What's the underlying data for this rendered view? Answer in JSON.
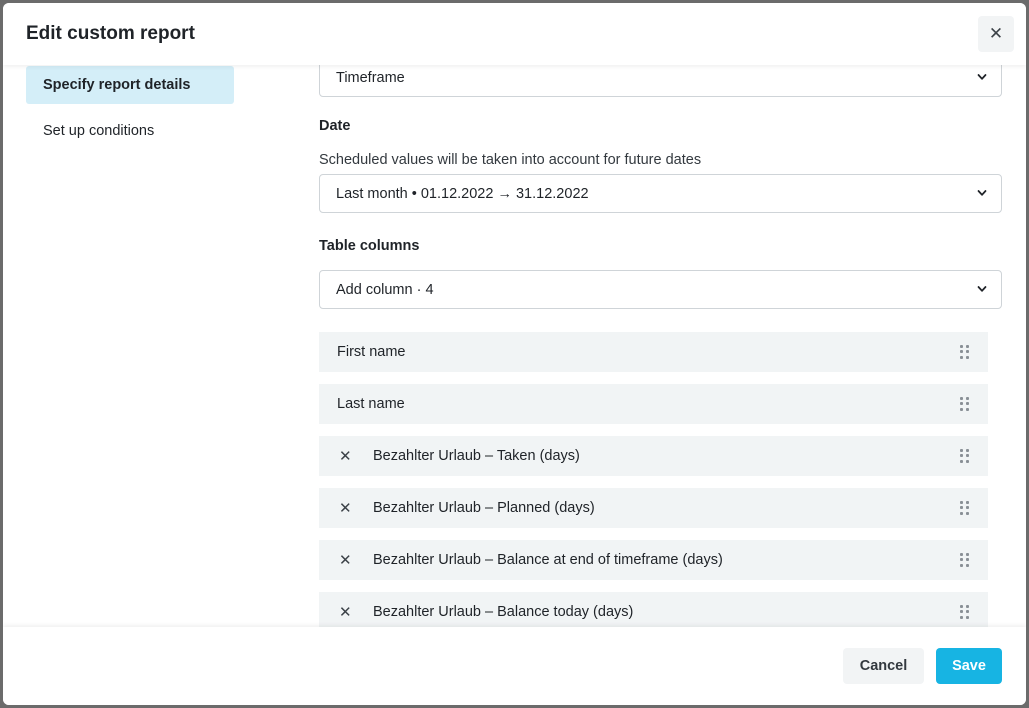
{
  "modal": {
    "title": "Edit custom report",
    "close_label": "✕"
  },
  "sidebar": {
    "items": [
      {
        "label": "Specify report details",
        "active": true
      },
      {
        "label": "Set up conditions",
        "active": false
      }
    ]
  },
  "form": {
    "timeframe_value": "Timeframe",
    "date_label": "Date",
    "date_hint": "Scheduled values will be taken into account for future dates",
    "date_value": "Last month • 01.12.2022 → 31.12.2022",
    "columns_label": "Table columns",
    "add_column_value": "Add column · 4",
    "columns": [
      {
        "label": "First name",
        "removable": false
      },
      {
        "label": "Last name",
        "removable": false
      },
      {
        "label": "Bezahlter Urlaub – Taken (days)",
        "removable": true
      },
      {
        "label": "Bezahlter Urlaub – Planned (days)",
        "removable": true
      },
      {
        "label": "Bezahlter Urlaub – Balance at end of timeframe (days)",
        "removable": true
      },
      {
        "label": "Bezahlter Urlaub – Balance today (days)",
        "removable": true
      }
    ],
    "remove_glyph": "✕"
  },
  "footer": {
    "cancel_label": "Cancel",
    "save_label": "Save"
  },
  "colors": {
    "accent": "#17b4e3",
    "sidebar_active": "#d4eef8",
    "row_background": "#f1f4f5"
  }
}
